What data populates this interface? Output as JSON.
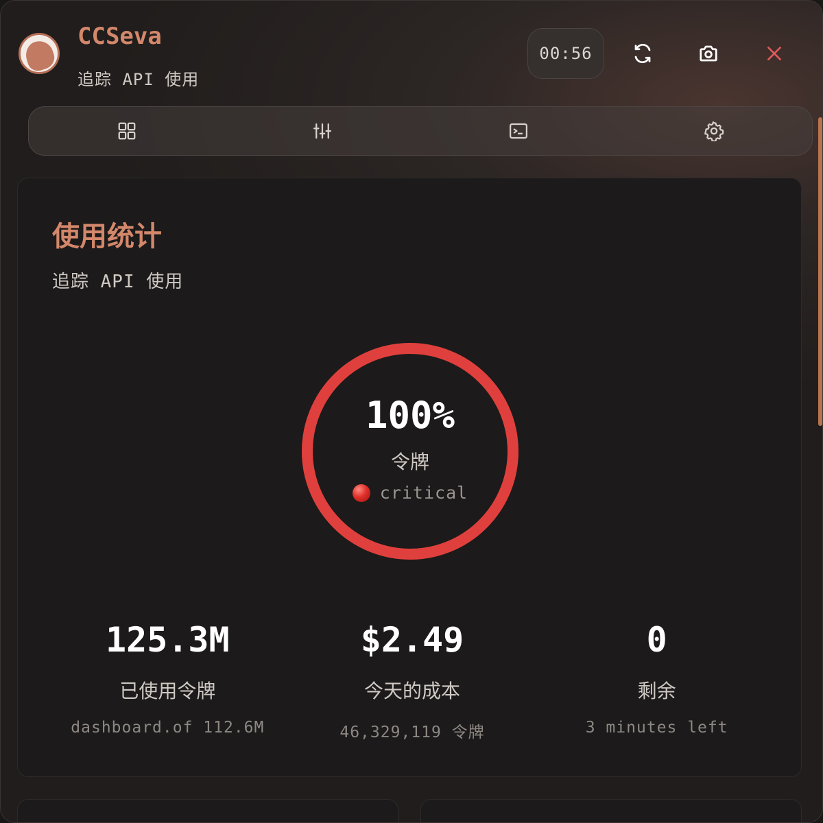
{
  "app": {
    "title": "CCSeva",
    "subtitle": "追踪 API 使用",
    "timer": "00:56"
  },
  "header_actions": [
    "refresh-icon",
    "camera-icon",
    "close-icon"
  ],
  "tabs": [
    {
      "icon": "grid-icon"
    },
    {
      "icon": "sliders-icon"
    },
    {
      "icon": "terminal-icon"
    },
    {
      "icon": "gear-icon"
    }
  ],
  "usage": {
    "title": "使用统计",
    "subtitle": "追踪 API 使用",
    "gauge": {
      "value": "100%",
      "percent": 100,
      "label": "令牌",
      "status": "critical",
      "color": "#e0403d"
    },
    "stats": [
      {
        "value": "125.3M",
        "label": "已使用令牌",
        "sub": "dashboard.of 112.6M"
      },
      {
        "value": "$2.49",
        "label": "今天的成本",
        "sub": "46,329,119 令牌"
      },
      {
        "value": "0",
        "label": "剩余",
        "sub": "3 minutes left"
      }
    ]
  },
  "colors": {
    "accent": "#d3876b",
    "critical": "#e0403d",
    "close": "#e05a5a"
  }
}
